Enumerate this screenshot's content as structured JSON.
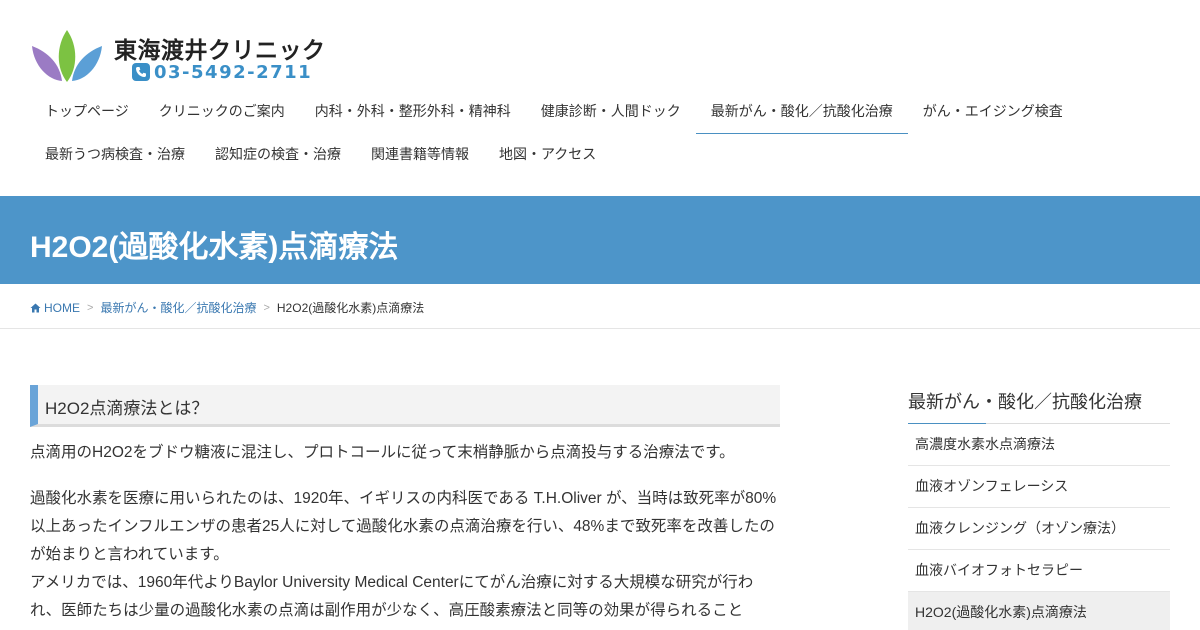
{
  "site": {
    "name": "東海渡井クリニック",
    "tel": "03-5492-2711"
  },
  "colors": {
    "accent": "#4d95c9",
    "tel_blue": "#3a8fc7",
    "leaf_purple": "#9b7bc4",
    "leaf_green": "#7cc242",
    "leaf_blue": "#5b9fd6"
  },
  "nav": {
    "row1": [
      "トップページ",
      "クリニックのご案内",
      "内科・外科・整形外科・精神科",
      "健康診断・人間ドック",
      "最新がん・酸化／抗酸化治療",
      "がん・エイジング検査"
    ],
    "row2": [
      "最新うつ病検査・治療",
      "認知症の検査・治療",
      "関連書籍等情報",
      "地図・アクセス"
    ]
  },
  "page": {
    "title": "H2O2(過酸化水素)点滴療法"
  },
  "breadcrumb": {
    "home": "HOME",
    "category": "最新がん・酸化／抗酸化治療",
    "current": "H2O2(過酸化水素)点滴療法"
  },
  "main": {
    "heading": "H2O2点滴療法とは？",
    "p1": "点滴用のH2O2をブドウ糖液に混注し、プロトコールに従って末梢静脈から点滴投与する治療法です。",
    "p2": "過酸化水素を医療に用いられたのは、1920年、イギリスの内科医である T.H.Oliver が、当時は致死率が80%以上あったインフルエンザの患者25人に対して過酸化水素の点滴治療を行い、48%まで致死率を改善したのが始まりと言われています。",
    "p3": "アメリカでは、1960年代よりBaylor University Medical Centerにてがん治療に対する大規模な研究が行われ、医師たちは少量の過酸化水素の点滴は副作用が少なく、高圧酸素療法と同等の効果が得られること"
  },
  "sidebar": {
    "title": "最新がん・酸化／抗酸化治療",
    "items": [
      "高濃度水素水点滴療法",
      "血液オゾンフェレーシス",
      "血液クレンジング（オゾン療法）",
      "血液バイオフォトセラピー",
      "H2O2(過酸化水素)点滴療法"
    ]
  }
}
